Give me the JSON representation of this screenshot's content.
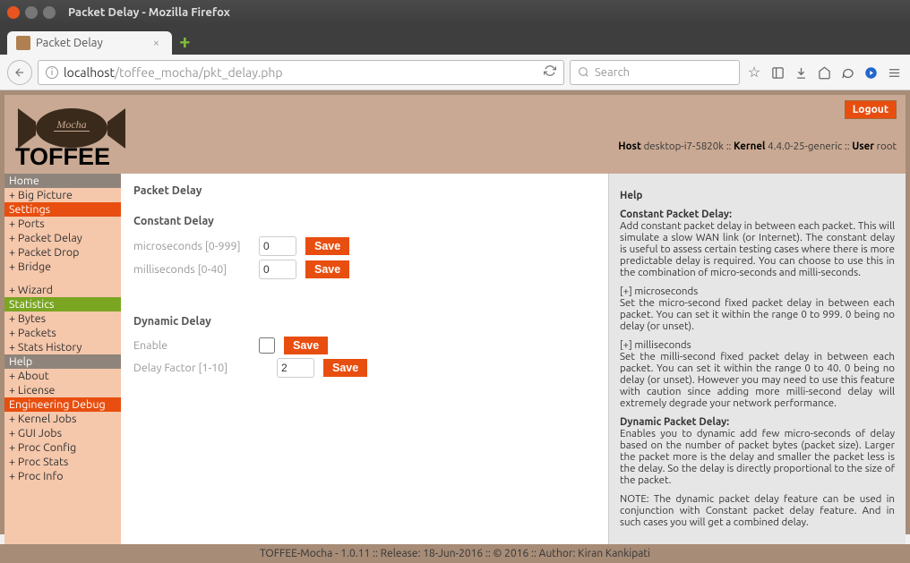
{
  "window": {
    "title": "Packet Delay - Mozilla Firefox"
  },
  "tab": {
    "title": "Packet Delay"
  },
  "url": {
    "host": "localhost",
    "path": "/toffee_mocha/pkt_delay.php"
  },
  "search": {
    "placeholder": "Search"
  },
  "header": {
    "logout": "Logout",
    "host_label": "Host",
    "host": "desktop-i7-5820k",
    "kernel_label": "Kernel",
    "kernel": "4.4.0-25-generic",
    "user_label": "User",
    "user": "root"
  },
  "sidebar": {
    "home": "Home",
    "big_picture": "+ Big Picture",
    "settings": "Settings",
    "ports": "+ Ports",
    "packet_delay": "+ Packet Delay",
    "packet_drop": "+ Packet Drop",
    "bridge": "+ Bridge",
    "wizard": "+ Wizard",
    "statistics": "Statistics",
    "bytes": "+ Bytes",
    "packets": "+ Packets",
    "stats_history": "+ Stats History",
    "help": "Help",
    "about": "+ About",
    "license": "+ License",
    "eng_debug": "Engineering Debug",
    "kernel_jobs": "+ Kernel Jobs",
    "gui_jobs": "+ GUI Jobs",
    "proc_config": "+ Proc Config",
    "proc_stats": "+ Proc Stats",
    "proc_info": "+ Proc Info"
  },
  "main": {
    "title": "Packet Delay",
    "constant_title": "Constant Delay",
    "microseconds_label": "microseconds [0-999]",
    "microseconds_value": "0",
    "milliseconds_label": "milliseconds [0-40]",
    "milliseconds_value": "0",
    "dynamic_title": "Dynamic Delay",
    "enable_label": "Enable",
    "delay_factor_label": "Delay Factor [1-10]",
    "delay_factor_value": "2",
    "save": "Save"
  },
  "help": {
    "title": "Help",
    "cpd_title": "Constant Packet Delay:",
    "cpd_body": "Add constant packet delay in between each packet. This will simulate a slow WAN link (or Internet). The constant delay is useful to assess certain testing cases where there is more predictable delay is required. You can choose to use this in the combination of micro-seconds and milli-seconds.",
    "micro_title": "[+] microseconds",
    "micro_body": "Set the micro-second fixed packet delay in between each packet. You can set it within the range 0 to 999. 0 being no delay (or unset).",
    "milli_title": "[+] milliseconds",
    "milli_body": "Set the milli-second fixed packet delay in between each packet. You can set it within the range 0 to 40. 0 being no delay (or unset). However you may need to use this feature with caution since adding more milli-second delay will extremely degrade your network performance.",
    "dpd_title": "Dynamic Packet Delay:",
    "dpd_body": "Enables you to dynamic add few micro-seconds of delay based on the number of packet bytes (packet size). Larger the packet more is the delay and smaller the packet less is the delay. So the delay is directly proportional to the size of the packet.",
    "dpd_note": "NOTE: The dynamic packet delay feature can be used in conjunction with Constant packet delay feature. And in such cases you will get a combined delay."
  },
  "footer": "TOFFEE-Mocha - 1.0.11 :: Release: 18-Jun-2016 :: © 2016 :: Author: Kiran Kankipati"
}
